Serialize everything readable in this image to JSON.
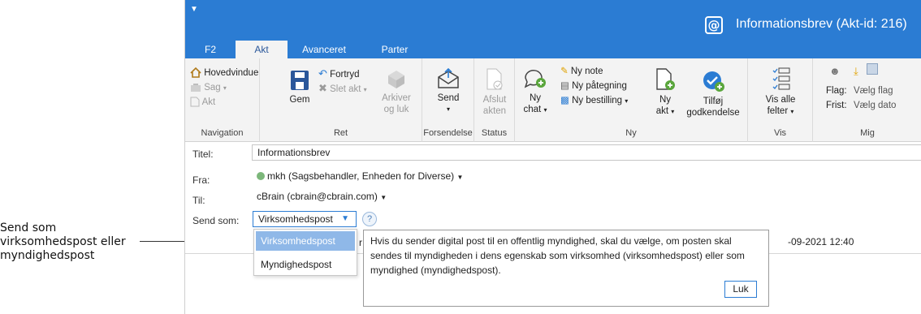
{
  "callout": {
    "text_lines": [
      "Send som",
      "virksomhedspost eller",
      "myndighedspost"
    ]
  },
  "window": {
    "title": "Informationsbrev (Akt-id: 216)",
    "app_icon": "@",
    "accent": "#2b7cd3"
  },
  "tabs": [
    {
      "label": "F2"
    },
    {
      "label": "Akt"
    },
    {
      "label": "Avanceret"
    },
    {
      "label": "Parter"
    }
  ],
  "ribbon": {
    "navigation": {
      "label": "Navigation",
      "items": [
        "Hovedvindue",
        "Sag",
        "Akt"
      ]
    },
    "ret": {
      "label": "Ret",
      "gem": "Gem",
      "fortryd": "Fortryd",
      "slet_akt": "Slet akt",
      "arkiver_line1": "Arkiver",
      "arkiver_line2": "og luk"
    },
    "forsendelse": {
      "label": "Forsendelse",
      "send": "Send"
    },
    "status": {
      "label": "Status",
      "afslut_line1": "Afslut",
      "afslut_line2": "akten"
    },
    "ny": {
      "label": "Ny",
      "ny_chat_line1": "Ny",
      "ny_chat_line2": "chat",
      "ny_note": "Ny note",
      "ny_paategning": "Ny påtegning",
      "ny_bestilling": "Ny bestilling",
      "ny_akt_line1": "Ny",
      "ny_akt_line2": "akt",
      "tilfoej_line1": "Tilføj",
      "tilfoej_line2": "godkendelse"
    },
    "vis": {
      "label": "Vis",
      "vis_alle_line1": "Vis alle",
      "vis_alle_line2": "felter"
    },
    "mig": {
      "label": "Mig",
      "flag_label": "Flag:",
      "flag_value": "Vælg flag",
      "frist_label": "Frist:",
      "frist_value": "Vælg dato"
    }
  },
  "form": {
    "titel_label": "Titel:",
    "titel_value": "Informationsbrev",
    "fra_label": "Fra:",
    "fra_value": "mkh (Sagsbehandler, Enheden for Diverse)",
    "til_label": "Til:",
    "til_value": "cBrain (cbrain@cbrain.com)",
    "send_som_label": "Send som:",
    "send_som_value": "Virksomhedspost",
    "options": [
      "Virksomhedspost",
      "Myndighedspost"
    ],
    "help_symbol": "?",
    "bg_prefix": "r",
    "bg_date": "-09-2021 12:40"
  },
  "tooltip": {
    "text": "Hvis du sender digital post til en offentlig myndighed, skal du vælge, om posten skal sendes til myndigheden i dens egenskab som virksomhed (virksomhedspost) eller som myndighed (myndighedspost).",
    "close_label": "Luk"
  }
}
